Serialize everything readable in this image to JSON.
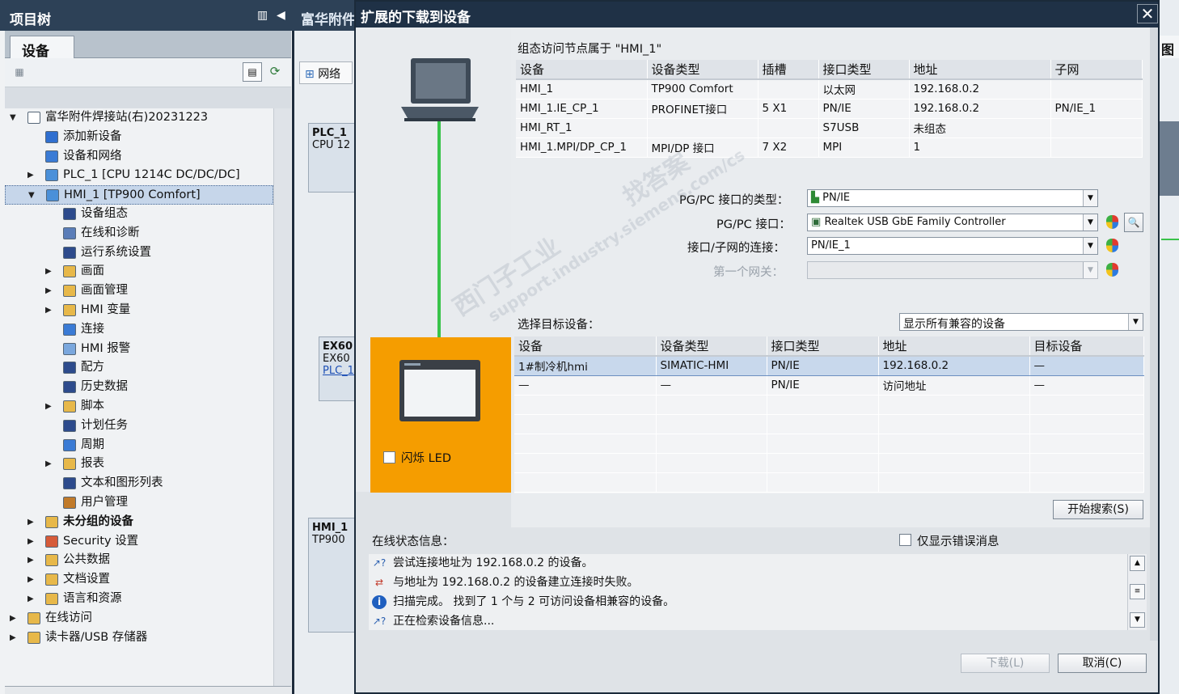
{
  "tree_panel": {
    "title": "项目树",
    "collapse_glyph": "◀",
    "layout_glyph": "▥",
    "tab": "设备",
    "items": [
      {
        "label": "富华附件焊接站(右)20231223",
        "level": 0,
        "expand": "▼",
        "icon": "project-icon",
        "color": "#ffffff",
        "bold": false
      },
      {
        "label": "添加新设备",
        "level": 1,
        "expand": "",
        "icon": "add-device-icon",
        "color": "#2f6fd0",
        "bold": false
      },
      {
        "label": "设备和网络",
        "level": 1,
        "expand": "",
        "icon": "network-icon",
        "color": "#3a7bd5",
        "bold": false
      },
      {
        "label": "PLC_1 [CPU 1214C DC/DC/DC]",
        "level": 1,
        "expand": "▶",
        "icon": "plc-icon",
        "color": "#4a90d9",
        "bold": false
      },
      {
        "label": "HMI_1 [TP900 Comfort]",
        "level": 1,
        "expand": "▼",
        "icon": "hmi-icon",
        "color": "#4a90d9",
        "bold": false,
        "selected": true
      },
      {
        "label": "设备组态",
        "level": 2,
        "expand": "",
        "icon": "device-config-icon",
        "color": "#2d4b8c",
        "bold": false
      },
      {
        "label": "在线和诊断",
        "level": 2,
        "expand": "",
        "icon": "online-diagnostics-icon",
        "color": "#5a7db8",
        "bold": false
      },
      {
        "label": "运行系统设置",
        "level": 2,
        "expand": "",
        "icon": "runtime-settings-icon",
        "color": "#2d4b8c",
        "bold": false
      },
      {
        "label": "画面",
        "level": 2,
        "expand": "▶",
        "icon": "screens-folder-icon",
        "color": "#e7b84a",
        "bold": false
      },
      {
        "label": "画面管理",
        "level": 2,
        "expand": "▶",
        "icon": "screen-management-icon",
        "color": "#e7b84a",
        "bold": false
      },
      {
        "label": "HMI 变量",
        "level": 2,
        "expand": "▶",
        "icon": "hmi-tags-icon",
        "color": "#e7b84a",
        "bold": false
      },
      {
        "label": "连接",
        "level": 2,
        "expand": "",
        "icon": "connections-icon",
        "color": "#3a7bd5",
        "bold": false
      },
      {
        "label": "HMI 报警",
        "level": 2,
        "expand": "",
        "icon": "hmi-alarms-icon",
        "color": "#7aa7dd",
        "bold": false
      },
      {
        "label": "配方",
        "level": 2,
        "expand": "",
        "icon": "recipes-icon",
        "color": "#2d4b8c",
        "bold": false
      },
      {
        "label": "历史数据",
        "level": 2,
        "expand": "",
        "icon": "historical-data-icon",
        "color": "#2d4b8c",
        "bold": false
      },
      {
        "label": "脚本",
        "level": 2,
        "expand": "▶",
        "icon": "scripts-icon",
        "color": "#e7b84a",
        "bold": false
      },
      {
        "label": "计划任务",
        "level": 2,
        "expand": "",
        "icon": "scheduled-tasks-icon",
        "color": "#2d4b8c",
        "bold": false
      },
      {
        "label": "周期",
        "level": 2,
        "expand": "",
        "icon": "cycles-icon",
        "color": "#3a7bd5",
        "bold": false
      },
      {
        "label": "报表",
        "level": 2,
        "expand": "▶",
        "icon": "reports-icon",
        "color": "#e7b84a",
        "bold": false
      },
      {
        "label": "文本和图形列表",
        "level": 2,
        "expand": "",
        "icon": "text-graphic-lists-icon",
        "color": "#2d4b8c",
        "bold": false
      },
      {
        "label": "用户管理",
        "level": 2,
        "expand": "",
        "icon": "user-management-icon",
        "color": "#c07a2a",
        "bold": false
      },
      {
        "label": "未分组的设备",
        "level": 1,
        "expand": "▶",
        "icon": "ungrouped-devices-icon",
        "color": "#e7b84a",
        "bold": true
      },
      {
        "label": "Security 设置",
        "level": 1,
        "expand": "▶",
        "icon": "security-settings-icon",
        "color": "#d65b3a",
        "bold": false
      },
      {
        "label": "公共数据",
        "level": 1,
        "expand": "▶",
        "icon": "common-data-icon",
        "color": "#e7b84a",
        "bold": false
      },
      {
        "label": "文档设置",
        "level": 1,
        "expand": "▶",
        "icon": "documentation-settings-icon",
        "color": "#e7b84a",
        "bold": false
      },
      {
        "label": "语言和资源",
        "level": 1,
        "expand": "▶",
        "icon": "languages-resources-icon",
        "color": "#e7b84a",
        "bold": false
      },
      {
        "label": "在线访问",
        "level": 0,
        "expand": "▶",
        "icon": "online-access-icon",
        "color": "#e7b84a",
        "bold": false
      },
      {
        "label": "读卡器/USB 存储器",
        "level": 0,
        "expand": "▶",
        "icon": "card-reader-usb-icon",
        "color": "#e7b84a",
        "bold": false
      }
    ]
  },
  "background": {
    "editor_title": "富华附件",
    "network_button": "网络",
    "plc_box": {
      "name": "PLC_1",
      "type": "CPU 12"
    },
    "ex_box": {
      "name": "EX60",
      "type": "EX60",
      "link": "PLC_1"
    },
    "hmi_box": {
      "name": "HMI_1",
      "type": "TP900"
    },
    "right_tab": "图"
  },
  "dialog": {
    "title": "扩展的下载到设备",
    "close_glyph": "✕",
    "config_caption": "组态访问节点属于 \"HMI_1\"",
    "config_table": {
      "headers": [
        "设备",
        "设备类型",
        "插槽",
        "接口类型",
        "地址",
        "子网"
      ],
      "rows": [
        [
          "HMI_1",
          "TP900 Comfort",
          "",
          "以太网",
          "192.168.0.2",
          ""
        ],
        [
          "HMI_1.IE_CP_1",
          "PROFINET接口",
          "5 X1",
          "PN/IE",
          "192.168.0.2",
          "PN/IE_1"
        ],
        [
          "HMI_RT_1",
          "",
          "",
          "S7USB",
          "未组态",
          ""
        ],
        [
          "HMI_1.MPI/DP_CP_1",
          "MPI/DP 接口",
          "7 X2",
          "MPI",
          "1",
          ""
        ]
      ]
    },
    "pgpc_type_label": "PG/PC 接口的类型：",
    "pgpc_type_value": "PN/IE",
    "pgpc_iface_label": "PG/PC 接口：",
    "pgpc_iface_value": "Realtek USB GbE Family Controller",
    "subnet_label": "接口/子网的连接：",
    "subnet_value": "PN/IE_1",
    "gateway_label": "第一个网关：",
    "gateway_value": "",
    "target_label": "选择目标设备：",
    "target_filter": "显示所有兼容的设备",
    "led_label": "闪烁 LED",
    "target_table": {
      "headers": [
        "设备",
        "设备类型",
        "接口类型",
        "地址",
        "目标设备"
      ],
      "rows": [
        [
          "1#制冷机hmi",
          "SIMATIC-HMI",
          "PN/IE",
          "192.168.0.2",
          "—"
        ],
        [
          "—",
          "—",
          "PN/IE",
          "访问地址",
          "—"
        ]
      ]
    },
    "search_button": "开始搜索(S)",
    "status_label": "在线状态信息：",
    "errors_only_label": "仅显示错误消息",
    "status_messages": [
      {
        "icon": "connection-attempt-icon",
        "glyph": "↗?",
        "text": "尝试连接地址为 192.168.0.2 的设备。"
      },
      {
        "icon": "connection-failed-icon",
        "glyph": "⇄",
        "text": "与地址为 192.168.0.2 的设备建立连接时失败。"
      },
      {
        "icon": "info-icon",
        "glyph": "i",
        "text": "扫描完成。 找到了 1 个与 2 可访问设备相兼容的设备。"
      },
      {
        "icon": "connection-attempt-icon",
        "glyph": "↗?",
        "text": "正在检索设备信息..."
      }
    ],
    "download_button": "下载(L)",
    "cancel_button": "取消(C)"
  },
  "watermark": [
    "西门子工业",
    "找答案",
    "support.industry.siemens.com/cs"
  ]
}
